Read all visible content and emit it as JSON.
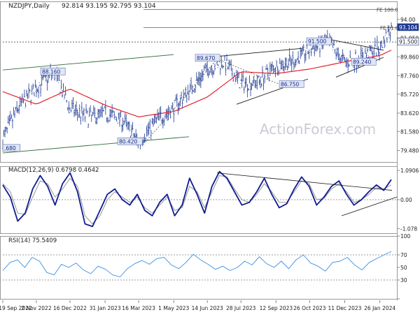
{
  "header": {
    "symbol": "NZDJPY,Daily",
    "ohlc": "92.814 93.195 92.795 93.104"
  },
  "watermark": "ActionForex.com",
  "colors": {
    "price": "#1f3a93",
    "ma": "#e3232f",
    "macd": "#101c92",
    "signal": "#8c8c8c",
    "rsi": "#3a8fe0",
    "trendline": "#1a1a1a",
    "channel": "#2f6b3b",
    "fibo": "#2e7d32",
    "label_fill": "#dfe6f5",
    "label_text": "#1b2a8a",
    "current_tag": "#1f3a93"
  },
  "chart_data": [
    {
      "type": "line",
      "name": "price-panel",
      "y_axis": {
        "ticks": [
          "94.00",
          "91.950",
          "89.860",
          "87.760",
          "85.720",
          "83.620",
          "81.580",
          "79.480"
        ],
        "range": [
          78.2,
          96.0
        ]
      },
      "x_axis": {
        "ticks": [
          "19 Sep 2022",
          "2 Nov 2022",
          "16 Dec 2022",
          "31 Jan 2023",
          "16 Mar 2023",
          "1 May 2023",
          "14 Jun 2023",
          "28 Jul 2023",
          "12 Sep 2023",
          "26 Oct 2023",
          "11 Dec 2023",
          "26 Jan 2024"
        ]
      },
      "series": [
        {
          "values_key": "close",
          "dates": [
            "2022-09-19",
            "2022-10-10",
            "2022-11-02",
            "2022-11-25",
            "2022-12-16",
            "2023-01-10",
            "2023-01-31",
            "2023-02-22",
            "2023-03-16",
            "2023-04-08",
            "2023-05-01",
            "2023-05-23",
            "2023-06-14",
            "2023-07-05",
            "2023-07-28",
            "2023-08-20",
            "2023-09-12",
            "2023-10-05",
            "2023-10-26",
            "2023-11-18",
            "2023-12-11",
            "2024-01-03",
            "2024-01-26",
            "2024-02-10"
          ],
          "values": [
            80.68,
            84.3,
            86.4,
            88.16,
            84.1,
            83.1,
            83.6,
            82.9,
            80.43,
            82.8,
            84.2,
            86.3,
            88.5,
            89.3,
            86.9,
            87.1,
            88.9,
            89.4,
            90.6,
            91.5,
            89.24,
            89.9,
            90.8,
            93.104
          ]
        },
        {
          "values_key": "moving_average",
          "dates": [
            "2022-09-19",
            "2022-11-02",
            "2022-12-16",
            "2023-01-31",
            "2023-03-16",
            "2023-05-01",
            "2023-06-14",
            "2023-07-28",
            "2023-09-12",
            "2023-10-26",
            "2023-12-11",
            "2024-01-26",
            "2024-02-10"
          ],
          "values": [
            86.0,
            84.6,
            86.3,
            84.5,
            83.2,
            83.8,
            85.4,
            88.2,
            88.0,
            88.5,
            89.3,
            90.0,
            90.6
          ]
        }
      ],
      "annotations": [
        {
          "text": "89.670",
          "value": 89.67
        },
        {
          "text": "88.160",
          "value": 88.16
        },
        {
          "text": "91.500",
          "value": 91.5
        },
        {
          "text": "86.750",
          "value": 86.75
        },
        {
          "text": "89.240",
          "value": 89.24
        },
        {
          "text": "80.420",
          "value": 80.42
        },
        {
          "text": ".680",
          "value": 79.68
        },
        {
          "text": "FE 100.0",
          "value": 95.1
        },
        {
          "text": "FE 61.8",
          "value": 93.1
        }
      ],
      "right_tags": [
        {
          "text": "93.104",
          "value": 93.104
        },
        {
          "text": "91.500",
          "value": 91.5
        }
      ]
    },
    {
      "type": "line",
      "name": "macd-panel",
      "title": "MACD(12,26,9) 0.6798 0.4642",
      "y_axis": {
        "ticks": [
          "1.0906",
          "0.00",
          "-1.078"
        ],
        "range": [
          -1.25,
          1.25
        ]
      },
      "series": [
        {
          "values_key": "macd",
          "values": [
            0.55,
            0.1,
            -0.8,
            -0.5,
            0.4,
            0.9,
            0.5,
            -0.2,
            0.6,
            1.0,
            0.3,
            -0.9,
            -1.0,
            -0.4,
            0.2,
            0.4,
            0.0,
            -0.2,
            0.2,
            -0.4,
            -0.6,
            -0.1,
            0.2,
            -0.6,
            -0.2,
            0.8,
            0.2,
            -0.5,
            0.5,
            1.05,
            0.8,
            0.3,
            -0.2,
            -0.1,
            0.3,
            0.8,
            0.2,
            -0.3,
            -0.15,
            0.4,
            0.85,
            0.5,
            -0.2,
            0.1,
            0.5,
            0.7,
            0.2,
            -0.2,
            0.0,
            0.3,
            0.55,
            0.35,
            0.75
          ]
        },
        {
          "values_key": "signal",
          "values": [
            0.6,
            0.3,
            -0.5,
            -0.55,
            0.1,
            0.7,
            0.6,
            0.1,
            0.4,
            0.8,
            0.5,
            -0.6,
            -0.9,
            -0.6,
            0.0,
            0.3,
            0.1,
            -0.1,
            0.1,
            -0.3,
            -0.5,
            -0.2,
            0.1,
            -0.4,
            -0.3,
            0.5,
            0.3,
            -0.3,
            0.3,
            0.9,
            0.85,
            0.4,
            0.0,
            -0.1,
            0.2,
            0.6,
            0.3,
            -0.1,
            -0.1,
            0.3,
            0.7,
            0.6,
            0.0,
            0.05,
            0.4,
            0.6,
            0.3,
            -0.1,
            0.0,
            0.2,
            0.45,
            0.4,
            0.55
          ]
        }
      ]
    },
    {
      "type": "line",
      "name": "rsi-panel",
      "title": "RSI(14) 75.5409",
      "y_axis": {
        "ticks": [
          "100",
          "70",
          "50",
          "30",
          "0"
        ],
        "range": [
          0,
          100
        ]
      },
      "series": [
        {
          "values_key": "rsi",
          "values": [
            45,
            58,
            62,
            50,
            66,
            60,
            42,
            38,
            55,
            50,
            57,
            46,
            40,
            52,
            47,
            38,
            35,
            48,
            56,
            61,
            55,
            64,
            66,
            54,
            48,
            58,
            71,
            62,
            55,
            47,
            52,
            45,
            50,
            60,
            54,
            67,
            56,
            50,
            60,
            48,
            62,
            70,
            57,
            52,
            44,
            58,
            60,
            66,
            54,
            46,
            58,
            64,
            70,
            75.5
          ]
        }
      ]
    }
  ]
}
